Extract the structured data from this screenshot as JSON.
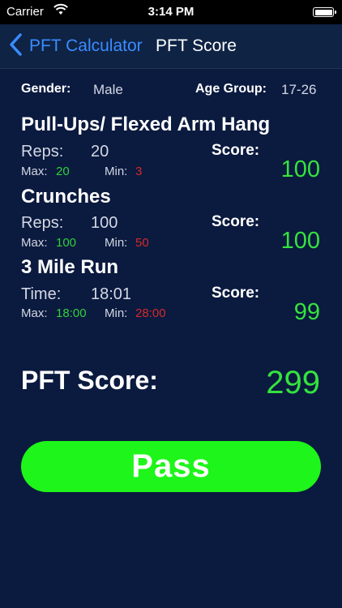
{
  "status_bar": {
    "carrier": "Carrier",
    "time": "3:14 PM"
  },
  "nav": {
    "back_label": "PFT Calculator",
    "title": "PFT Score"
  },
  "profile": {
    "gender_label": "Gender:",
    "gender_value": "Male",
    "age_group_label": "Age Group:",
    "age_group_value": "17-26"
  },
  "events": [
    {
      "title": "Pull-Ups/ Flexed Arm Hang",
      "metric_label": "Reps:",
      "metric_value": "20",
      "max_label": "Max:",
      "max_value": "20",
      "min_label": "Min:",
      "min_value": "3",
      "score_label": "Score:",
      "score_value": "100"
    },
    {
      "title": "Crunches",
      "metric_label": "Reps:",
      "metric_value": "100",
      "max_label": "Max:",
      "max_value": "100",
      "min_label": "Min:",
      "min_value": "50",
      "score_label": "Score:",
      "score_value": "100"
    },
    {
      "title": "3 Mile Run",
      "metric_label": "Time:",
      "metric_value": "18:01",
      "max_label": "Max:",
      "max_value": "18:00",
      "min_label": "Min:",
      "min_value": "28:00",
      "score_label": "Score:",
      "score_value": "99"
    }
  ],
  "total": {
    "label": "PFT Score:",
    "value": "299"
  },
  "result_button": {
    "label": "Pass"
  },
  "colors": {
    "background": "#0b1a3f",
    "accent_green": "#34e33d",
    "min_red": "#d42a2a",
    "link_blue": "#3a8cff"
  }
}
